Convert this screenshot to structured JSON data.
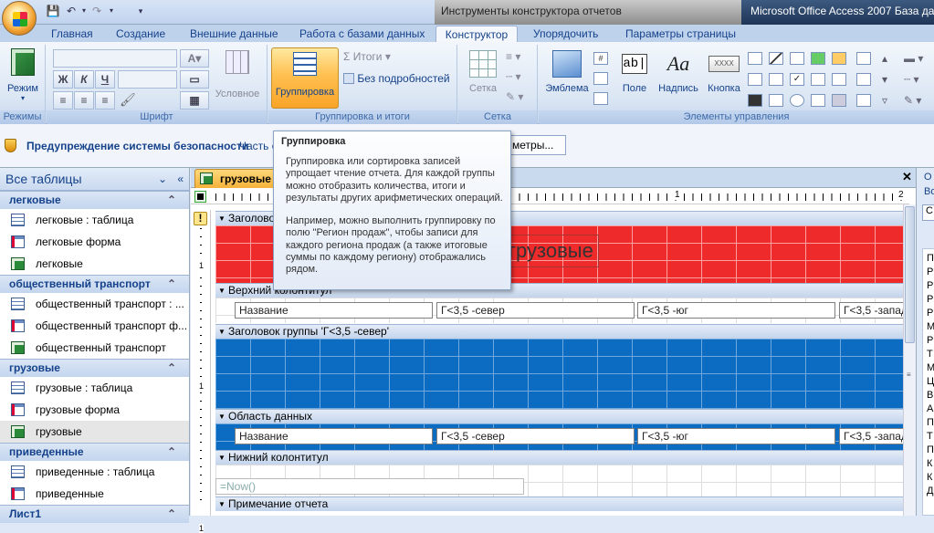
{
  "title_bar": {
    "tools_context": "Инструменты конструктора отчетов",
    "app_title": "Microsoft Office Access 2007 База данных"
  },
  "ribbon_tabs": [
    "Главная",
    "Создание",
    "Внешние данные",
    "Работа с базами данных",
    "Конструктор",
    "Упорядочить",
    "Параметры страницы"
  ],
  "active_tab": "Конструктор",
  "ribbon": {
    "views": {
      "button": "Режим",
      "group": "Режимы"
    },
    "font": {
      "group": "Шрифт",
      "bold": "Ж",
      "italic": "К",
      "underline": "Ч",
      "conditional": "Условное"
    },
    "grouping": {
      "group": "Группировка и итоги",
      "button": "Группировка",
      "totals": "Итоги",
      "hide_details": "Без подробностей"
    },
    "grid": {
      "group": "Сетка",
      "button": "Сетка"
    },
    "controls": {
      "group": "Элементы управления",
      "logo": "Эмблема",
      "field": "Поле",
      "label": "Надпись",
      "button": "Кнопка",
      "label_glyph": "Aa",
      "field_glyph": "ab|",
      "button_glyph": "XXXX"
    }
  },
  "security_bar": {
    "warning": "Предупреждение системы безопасности",
    "message_part": "Часть с",
    "options_button": "метры..."
  },
  "nav_pane": {
    "header": "Все таблицы",
    "groups": [
      {
        "title": "легковые",
        "items": [
          {
            "label": "легковые : таблица",
            "type": "table"
          },
          {
            "label": "легковые форма",
            "type": "form"
          },
          {
            "label": "легковые",
            "type": "report"
          }
        ]
      },
      {
        "title": "общественный транспорт",
        "items": [
          {
            "label": "общественный транспорт : ...",
            "type": "table"
          },
          {
            "label": "общественный транспорт ф...",
            "type": "form"
          },
          {
            "label": "общественный транспорт",
            "type": "report"
          }
        ]
      },
      {
        "title": "грузовые",
        "items": [
          {
            "label": "грузовые : таблица",
            "type": "table"
          },
          {
            "label": "грузовые форма",
            "type": "form"
          },
          {
            "label": "грузовые",
            "type": "report"
          }
        ]
      },
      {
        "title": "приведенные",
        "items": [
          {
            "label": "приведенные : таблица",
            "type": "table"
          },
          {
            "label": "приведенные",
            "type": "form"
          }
        ]
      },
      {
        "title": "Лист1",
        "items": []
      }
    ],
    "selected_item": "грузовые"
  },
  "document": {
    "tab_label": "грузовые",
    "sections": {
      "report_header": "Заголовок",
      "page_header": "Верхний колонтитул",
      "group_header": "Заголовок группы 'Г<3,5 -север'",
      "detail": "Область данных",
      "page_footer": "Нижний колонтитул",
      "report_footer": "Примечание отчета"
    },
    "report_title": "грузовые",
    "columns": [
      "Название",
      "Г<3,5 -север",
      "Г<3,5 -юг",
      "Г<3,5 -запад"
    ],
    "footer_expr": "=Now()",
    "ruler_digits": [
      "1",
      "2"
    ],
    "vruler_digits": [
      "1",
      "1",
      "1"
    ]
  },
  "right_pane": {
    "top_labels": [
      "О",
      "Во",
      "С"
    ],
    "letters": [
      "П",
      "Р",
      "Р",
      "Р",
      "Р",
      "М",
      "Р",
      "Т",
      "М",
      "Ц",
      "В",
      "А",
      "П",
      "Т",
      "П",
      "К",
      "К",
      "Д"
    ]
  },
  "tooltip": {
    "title": "Группировка",
    "paragraphs": [
      "Группировка или сортировка записей упрощает чтение отчета. Для каждой группы можно отобразить количества, итоги и результаты других арифметических операций.",
      "Например, можно выполнить группировку по полю \"Регион продаж\", чтобы записи для каждого региона продаж (а также итоговые суммы по каждому региону) отображались рядом."
    ]
  },
  "colors": {
    "report_header_band": "#ee2a2a",
    "group_header_band": "#0b6cc2",
    "detail_band": "#0b6cc2",
    "accent": "#15428b"
  }
}
